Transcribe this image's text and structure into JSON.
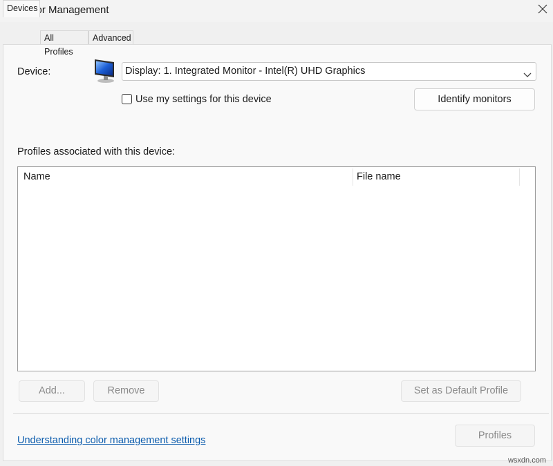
{
  "window": {
    "title": "Color Management",
    "close_icon": "close-icon"
  },
  "tabs": [
    {
      "label": "Devices",
      "active": true
    },
    {
      "label": "All Profiles",
      "active": false
    },
    {
      "label": "Advanced",
      "active": false
    }
  ],
  "devices": {
    "device_label": "Device:",
    "device_value": "Display: 1. Integrated Monitor - Intel(R) UHD Graphics",
    "use_settings_label": "Use my settings for this device",
    "use_settings_checked": false,
    "identify_button": "Identify monitors",
    "profiles_label": "Profiles associated with this device:",
    "columns": [
      "Name",
      "File name"
    ],
    "rows": [],
    "add_button": "Add...",
    "remove_button": "Remove",
    "set_default_button": "Set as Default Profile",
    "link_text": "Understanding color management settings",
    "profiles_button": "Profiles"
  },
  "watermark": "wsxdn.com",
  "colors": {
    "link": "#0b5cad",
    "disabled_text": "#8a8a8a",
    "panel_bg": "#f9f9f9"
  }
}
